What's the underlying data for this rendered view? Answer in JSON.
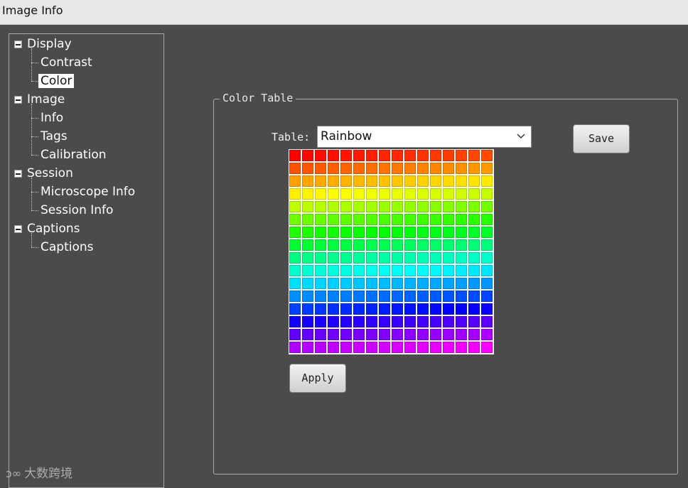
{
  "window": {
    "title": "Image Info"
  },
  "tree": {
    "items": [
      {
        "label": "Display",
        "level": 0,
        "expanded": true
      },
      {
        "label": "Contrast",
        "level": 1
      },
      {
        "label": "Color",
        "level": 1,
        "selected": true
      },
      {
        "label": "Image",
        "level": 0,
        "expanded": true
      },
      {
        "label": "Info",
        "level": 1
      },
      {
        "label": "Tags",
        "level": 1
      },
      {
        "label": "Calibration",
        "level": 1
      },
      {
        "label": "Session",
        "level": 0,
        "expanded": true
      },
      {
        "label": "Microscope Info",
        "level": 1
      },
      {
        "label": "Session Info",
        "level": 1
      },
      {
        "label": "Captions",
        "level": 0,
        "expanded": true
      },
      {
        "label": "Captions",
        "level": 1
      }
    ]
  },
  "color_table": {
    "group_title": "Color Table",
    "table_label": "Table:",
    "table_selected": "Rainbow",
    "save_label": "Save",
    "apply_label": "Apply",
    "palette": {
      "name": "Rainbow",
      "rows": 16,
      "cols": 16
    }
  },
  "watermark": {
    "text": "大数跨境"
  },
  "icons": {
    "toggle": "collapse-minus-icon",
    "dropdown": "chevron-down-icon",
    "watermark": "brand-logo-icon"
  }
}
